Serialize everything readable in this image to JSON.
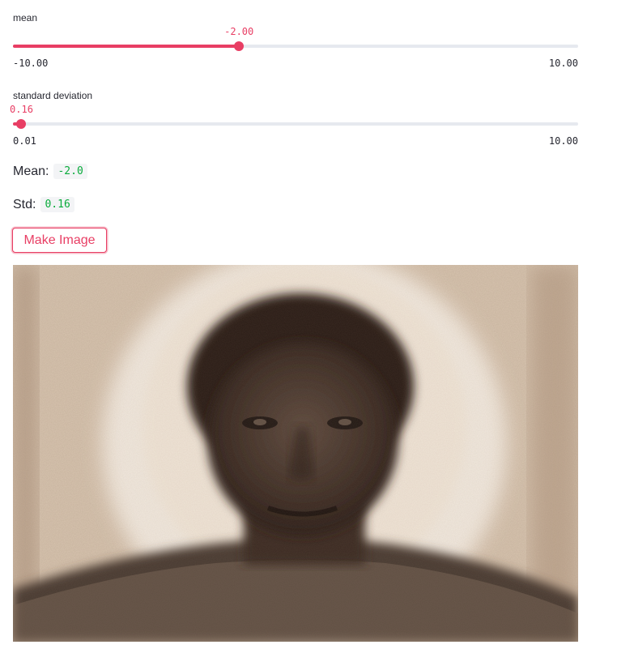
{
  "sliders": [
    {
      "label": "mean",
      "value_text": "-2.00",
      "min_text": "-10.00",
      "max_text": "10.00",
      "value": -2.0,
      "min": -10.0,
      "max": 10.0
    },
    {
      "label": "standard deviation",
      "value_text": "0.16",
      "min_text": "0.01",
      "max_text": "10.00",
      "value": 0.16,
      "min": 0.01,
      "max": 10.0
    }
  ],
  "stats": {
    "mean_label": "Mean:",
    "mean_value": "-2.0",
    "std_label": "Std:",
    "std_value": "0.16"
  },
  "button": {
    "label": "Make Image"
  },
  "colors": {
    "accent": "#e83e64",
    "code_text": "#09ab3b",
    "track": "#e6e9ef"
  },
  "image": {
    "description_icon": "generated-portrait-image"
  }
}
